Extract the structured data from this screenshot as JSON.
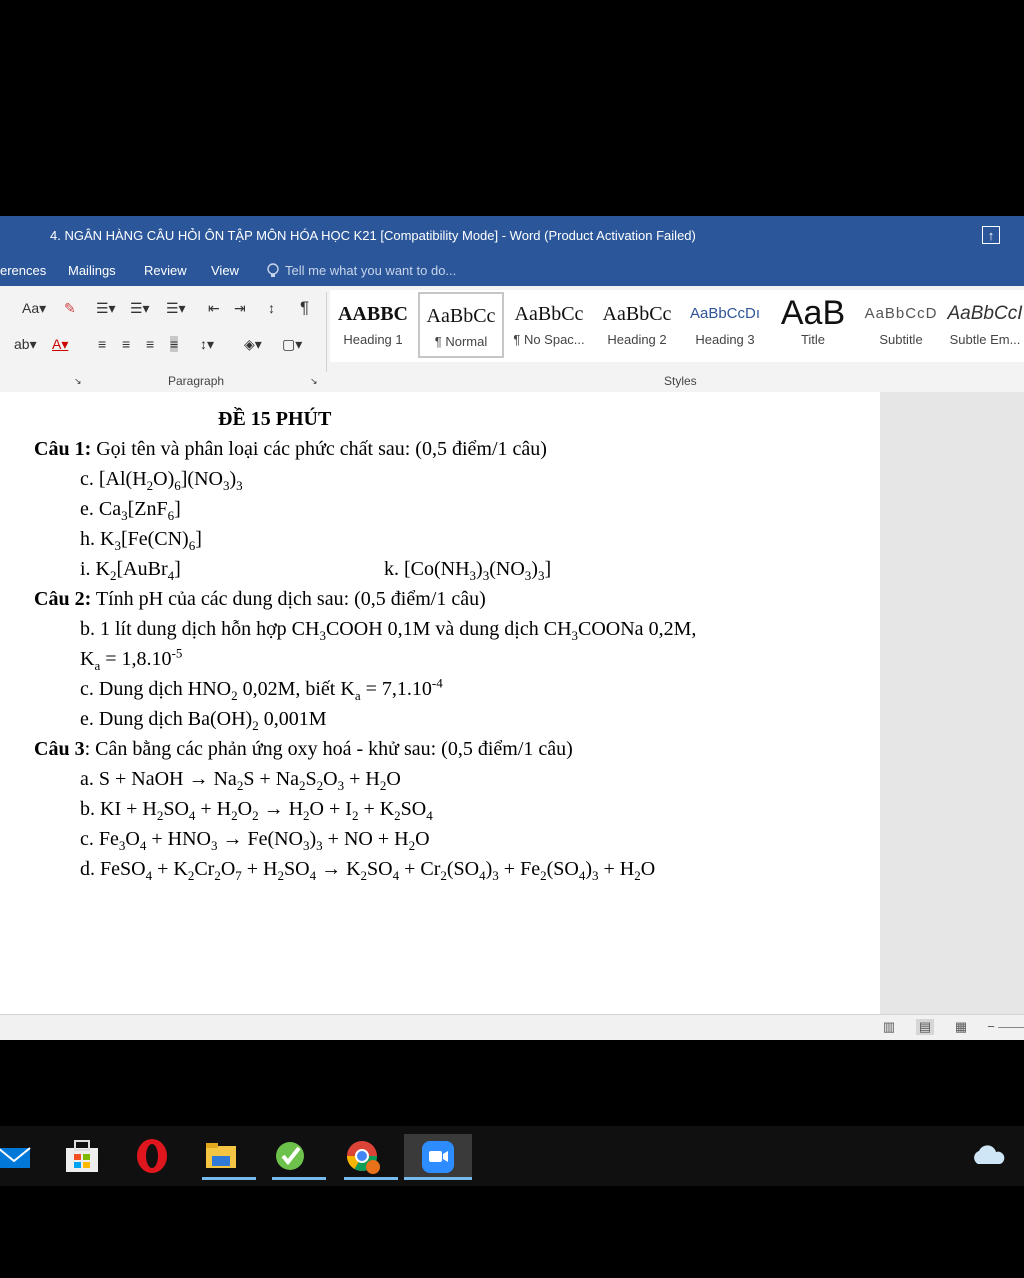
{
  "window": {
    "title": "4. NGÂN HÀNG CÂU HỎI ÔN TẬP MÔN HÓA HỌC K21 [Compatibility Mode] - Word (Product Activation Failed)"
  },
  "tabs": {
    "references": "erences",
    "mailings": "Mailings",
    "review": "Review",
    "view": "View",
    "tell_me": "Tell me what you want to do..."
  },
  "ribbon": {
    "font_size_btn": "Aa",
    "paragraph_label": "Paragraph",
    "styles_label": "Styles",
    "styles": [
      {
        "preview": "AABBC",
        "name": "Heading 1"
      },
      {
        "preview": "AaBbCc",
        "name": "¶ Normal"
      },
      {
        "preview": "AaBbCc",
        "name": "¶ No Spac..."
      },
      {
        "preview": "AaBbCc",
        "name": "Heading 2"
      },
      {
        "preview": "AaBbCcDı",
        "name": "Heading 3"
      },
      {
        "preview": "AaB",
        "name": "Title"
      },
      {
        "preview": "AaBbCcD",
        "name": "Subtitle"
      },
      {
        "preview": "AaBbCcI",
        "name": "Subtle Em..."
      }
    ]
  },
  "document": {
    "heading": "ĐỀ 15 PHÚT",
    "q1_label": "Câu 1:",
    "q1_text": " Gọi tên và phân loại các phức chất sau:  (0,5 điểm/1 câu)",
    "q2_label": "Câu 2:",
    "q2_text": " Tính pH của các dung dịch sau:   (0,5 điểm/1 câu)",
    "q3_label": "Câu 3",
    "q3_text": ": Cân bằng các phản ứng oxy hoá - khử sau:  (0,5 điểm/1 câu)"
  },
  "taskbar": {
    "apps": [
      "mail-icon",
      "store-icon",
      "opera-icon",
      "file-explorer-icon",
      "app-icon",
      "chrome-icon",
      "zoom-icon"
    ]
  }
}
